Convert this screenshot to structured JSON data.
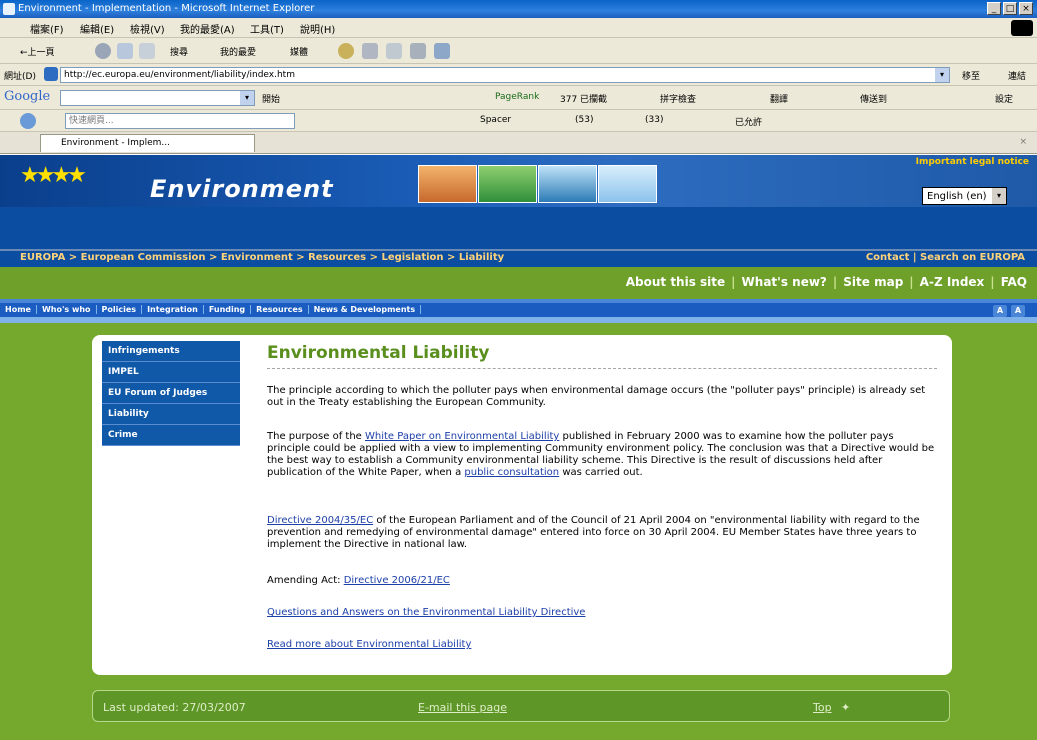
{
  "window": {
    "title": "Environment - Implementation - Microsoft Internet Explorer",
    "buttons": [
      "_",
      "□",
      "×"
    ]
  },
  "menubar": [
    "檔案(F)",
    "編輯(E)",
    "檢視(V)",
    "我的最愛(A)",
    "工具(T)",
    "說明(H)"
  ],
  "toolbar": {
    "back": "←上一頁",
    "search": "搜尋",
    "favorites": "我的最愛",
    "media": "媒體"
  },
  "address": {
    "label": "網址(D)",
    "url": "http://ec.europa.eu/environment/liability/index.htm",
    "go": "移至",
    "links": "連結"
  },
  "google": {
    "logo": "Google",
    "search_btn": "開始",
    "pagerank": "PageRank",
    "blocked": "377 已攔截",
    "spell": "拼字檢查",
    "translate": "翻譯",
    "send": "傳送到",
    "settings": "設定"
  },
  "linksbar": {
    "field": "快速網頁...",
    "spacer": "Spacer",
    "item1": "(53)",
    "item2": "(33)",
    "item3": "已允許"
  },
  "tab": {
    "label": "Environment - Implem..."
  },
  "banner": {
    "title": "Environment",
    "legal": "Important legal notice",
    "language": "English (en)"
  },
  "breadcrumb": "EUROPA > European Commission > Environment > Resources > Legislation > Liability",
  "crumb_right": "Contact | Search on EUROPA",
  "about_links": [
    "About this site",
    "What's new?",
    "Site map",
    "A-Z Index",
    "FAQ"
  ],
  "nav": [
    "Home",
    "Who's who",
    "Policies",
    "Integration",
    "Funding",
    "Resources",
    "News & Developments"
  ],
  "leftnav": [
    "Infringements",
    "IMPEL",
    "EU Forum of Judges",
    "Liability",
    "Crime"
  ],
  "content": {
    "heading": "Environmental Liability",
    "p1": "The principle according to which the polluter pays when environmental damage occurs (the \"polluter pays\" principle) is already set out in the Treaty establishing the European Community.",
    "p2_pre": "The purpose of the ",
    "p2_link": "White Paper on Environmental Liability",
    "p2_mid": " published in February 2000 was to examine how the polluter pays principle could be applied with a view to implementing Community environment policy. The conclusion was that a Directive would be the best way to establish a Community environmental liability scheme. This Directive is the result of discussions held after publication of the White Paper, when a ",
    "p2_link2": "public consultation",
    "p2_post": " was carried out.",
    "p3_link": "Directive 2004/35/EC",
    "p3_post": " of the European Parliament and of the Council of 21 April 2004 on \"environmental liability with regard to the prevention and remedying of environmental damage\" entered into force on 30 April 2004. EU Member States have three years to implement the Directive in national law.",
    "p4_pre": "Amending Act: ",
    "p4_link": "Directive 2006/21/EC",
    "qa_link": "Questions and Answers on the Environmental Liability Directive",
    "more_link": "Read more about Environmental Liability"
  },
  "footer": {
    "updated": "Last updated: 27/03/2007",
    "email": "E-mail this page",
    "top": "Top"
  }
}
